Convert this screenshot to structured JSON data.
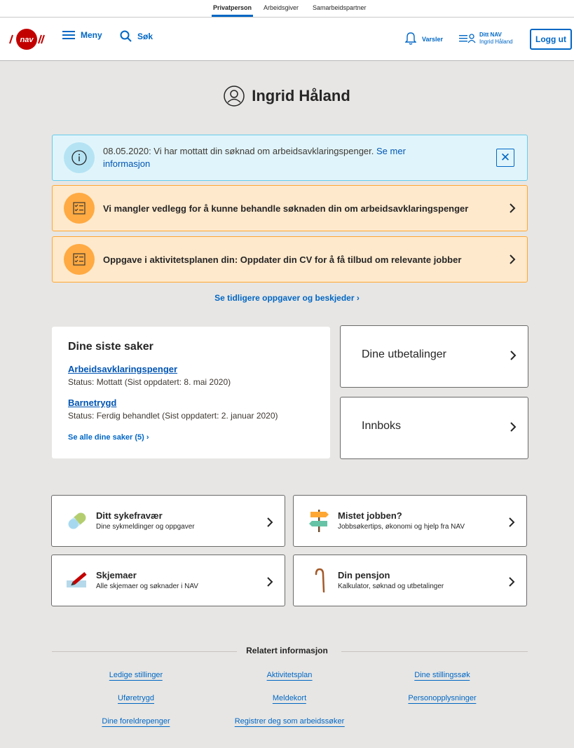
{
  "context_bar": {
    "items": [
      "Privatperson",
      "Arbeidsgiver",
      "Samarbeidspartner"
    ],
    "active": "Privatperson"
  },
  "header": {
    "menu_label": "Meny",
    "search_label": "Søk",
    "notifications_label": "Varsler",
    "ditt_nav_label": "Ditt NAV",
    "user_short": "Ingrid Håland",
    "logout_label": "Logg ut"
  },
  "user": {
    "name": "Ingrid Håland"
  },
  "alerts": {
    "info": {
      "text": "08.05.2020: Vi har mottatt din søknad om arbeidsavklaringspenger. ",
      "link_a": "Se mer",
      "link_b": "informasjon"
    },
    "task1": "Vi mangler vedlegg for å kunne behandle søknaden din om arbeidsavklaringspenger",
    "task2": "Oppgave i aktivitetsplanen din:  Oppdater din CV for å få tilbud om relevante jobber"
  },
  "earlier_link": "Se tidligere oppgaver og beskjeder",
  "cases": {
    "title": "Dine siste saker",
    "items": [
      {
        "name": "Arbeidsavklaringspenger",
        "status": "Status: Mottatt (Sist oppdatert: 8. mai 2020)"
      },
      {
        "name": "Barnetrygd",
        "status": "Status: Ferdig behandlet (Sist oppdatert: 2. januar 2020)"
      }
    ],
    "all_link": "Se alle dine saker (5)"
  },
  "cards": {
    "payments": "Dine utbetalinger",
    "inbox": "Innboks"
  },
  "panels": [
    {
      "title": "Ditt sykefravær",
      "subtitle": "Dine sykmeldinger og oppgaver",
      "icon": "pill-icon"
    },
    {
      "title": "Mistet jobben?",
      "subtitle": "Jobbsøkertips, økonomi og hjelp fra NAV",
      "icon": "signpost-icon"
    },
    {
      "title": "Skjemaer",
      "subtitle": "Alle skjemaer og søknader i NAV",
      "icon": "form-pen-icon"
    },
    {
      "title": "Din pensjon",
      "subtitle": "Kalkulator, søknad og utbetalinger",
      "icon": "walking-cane-icon"
    }
  ],
  "related": {
    "title": "Relatert informasjon",
    "links": [
      "Ledige stillinger",
      "Aktivitetsplan",
      "Dine stillingssøk",
      "Uføretrygd",
      "Meldekort",
      "Personopplysninger",
      "Dine foreldrepenger",
      "Registrer deg som arbeidssøker"
    ]
  },
  "colors": {
    "nav_red": "#c30000",
    "accent_blue": "#0067c5",
    "info_bg": "#e0f5fb",
    "warn_bg": "#ffe9cc",
    "page_bg": "#e7e6e4"
  }
}
